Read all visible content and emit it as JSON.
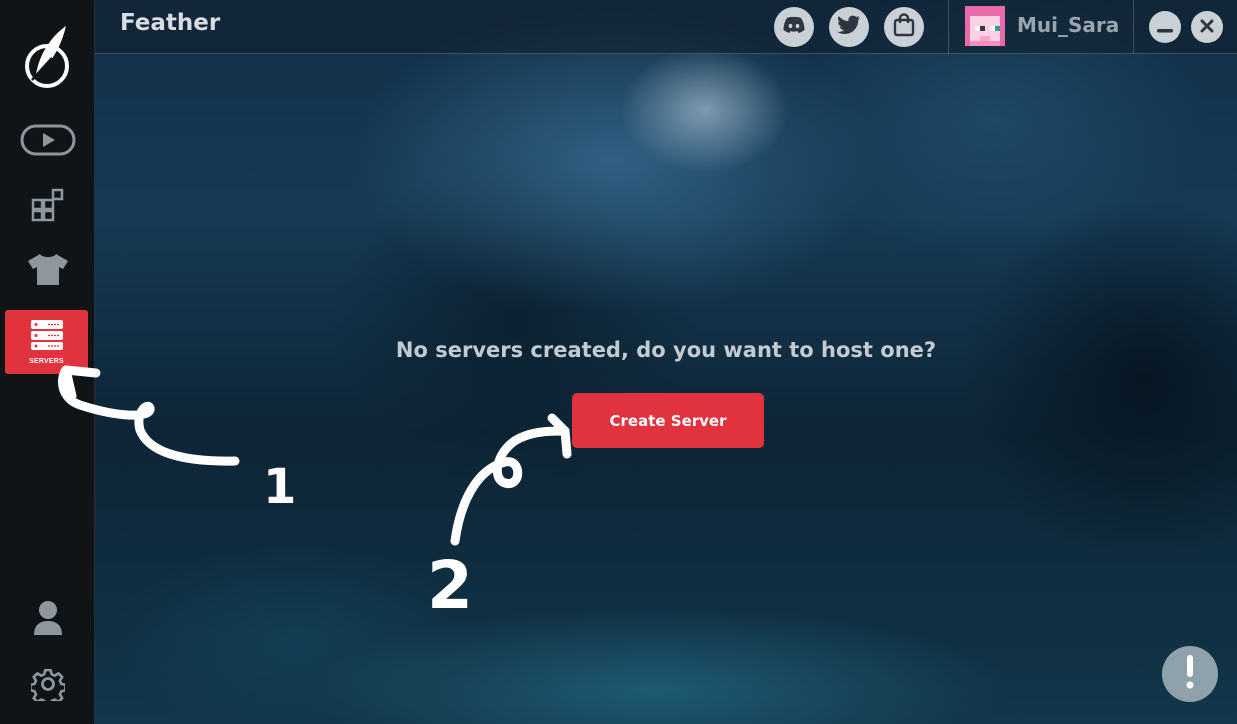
{
  "app": {
    "title": "Feather"
  },
  "sidebar": {
    "items": [
      {
        "id": "play",
        "icon": "play-icon"
      },
      {
        "id": "mods",
        "icon": "mods-grid-icon"
      },
      {
        "id": "cosmetics",
        "icon": "tshirt-icon"
      },
      {
        "id": "servers",
        "icon": "server-rack-icon",
        "label": "SERVERS",
        "active": true
      },
      {
        "id": "profile",
        "icon": "user-icon"
      },
      {
        "id": "settings",
        "icon": "gear-icon"
      }
    ]
  },
  "header": {
    "social": [
      {
        "id": "discord",
        "icon": "discord-icon"
      },
      {
        "id": "twitter",
        "icon": "twitter-icon"
      },
      {
        "id": "store",
        "icon": "shopping-bag-icon"
      }
    ],
    "user": {
      "name": "Mui_Sara",
      "avatar_icon": "pink-skin-avatar"
    },
    "window_controls": [
      {
        "id": "minimize",
        "icon": "minimize-icon"
      },
      {
        "id": "close",
        "icon": "close-icon"
      }
    ]
  },
  "main": {
    "empty_message": "No servers created, do you want to host one?",
    "create_button_label": "Create Server"
  },
  "help": {
    "icon": "exclamation-icon",
    "text": "!"
  },
  "annotations": {
    "labels": [
      "1",
      "2"
    ]
  },
  "colors": {
    "accent": "#e0333d",
    "sidebar_bg": "#111417",
    "icon_gray": "#c9d0d6",
    "username": "#9aa4ad"
  }
}
